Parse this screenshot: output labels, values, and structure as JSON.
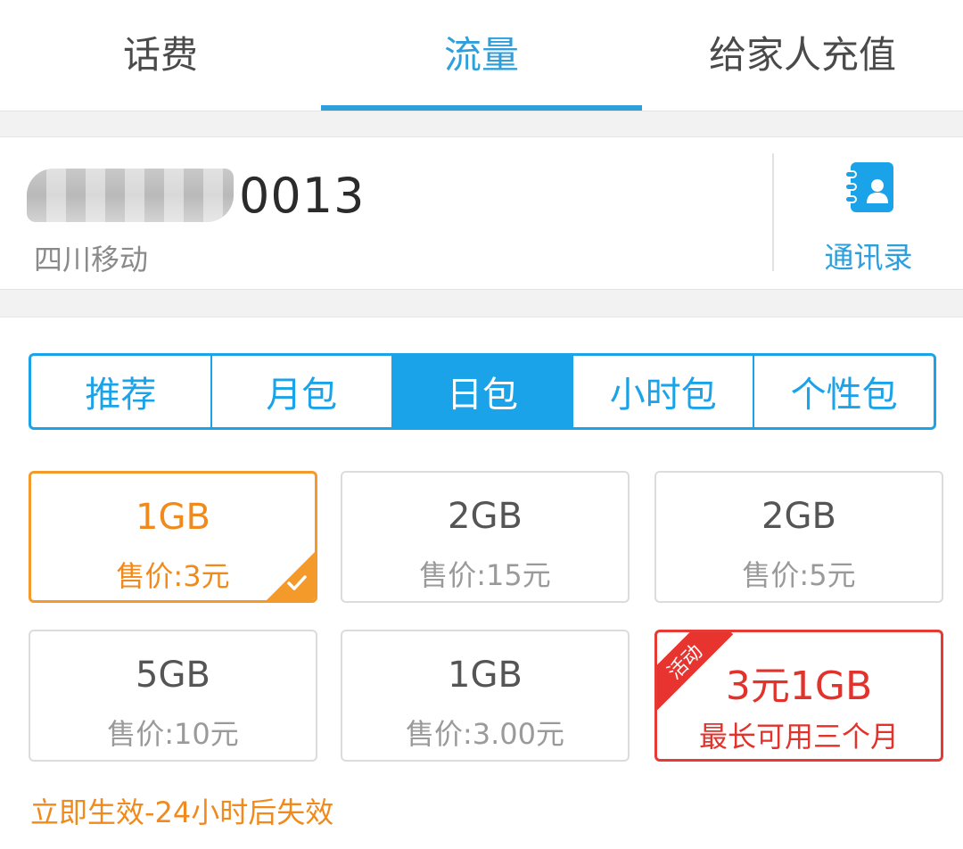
{
  "top_tabs": [
    {
      "label": "话费",
      "active": false
    },
    {
      "label": "流量",
      "active": true
    },
    {
      "label": "给家人充值",
      "active": false
    }
  ],
  "phone": {
    "number_visible": "0013",
    "carrier": "四川移动",
    "contacts_label": "通讯录",
    "contacts_icon": "contacts-book-icon"
  },
  "package_tabs": [
    {
      "label": "推荐",
      "active": false
    },
    {
      "label": "月包",
      "active": false
    },
    {
      "label": "日包",
      "active": true
    },
    {
      "label": "小时包",
      "active": false
    },
    {
      "label": "个性包",
      "active": false
    }
  ],
  "packages": [
    {
      "size": "1GB",
      "price": "售价:3元",
      "selected": true
    },
    {
      "size": "2GB",
      "price": "售价:15元",
      "selected": false
    },
    {
      "size": "2GB",
      "price": "售价:5元",
      "selected": false
    },
    {
      "size": "5GB",
      "price": "售价:10元",
      "selected": false
    },
    {
      "size": "1GB",
      "price": "售价:3.00元",
      "selected": false
    },
    {
      "size": "3元1GB",
      "price": "最长可用三个月",
      "selected": false,
      "badge": "活动"
    }
  ],
  "note": "立即生效-24小时后失效",
  "colors": {
    "accent_blue": "#1aa3e8",
    "tab_blue": "#2f9fdb",
    "selected_orange": "#f39a2a",
    "promo_red": "#e63a35"
  }
}
